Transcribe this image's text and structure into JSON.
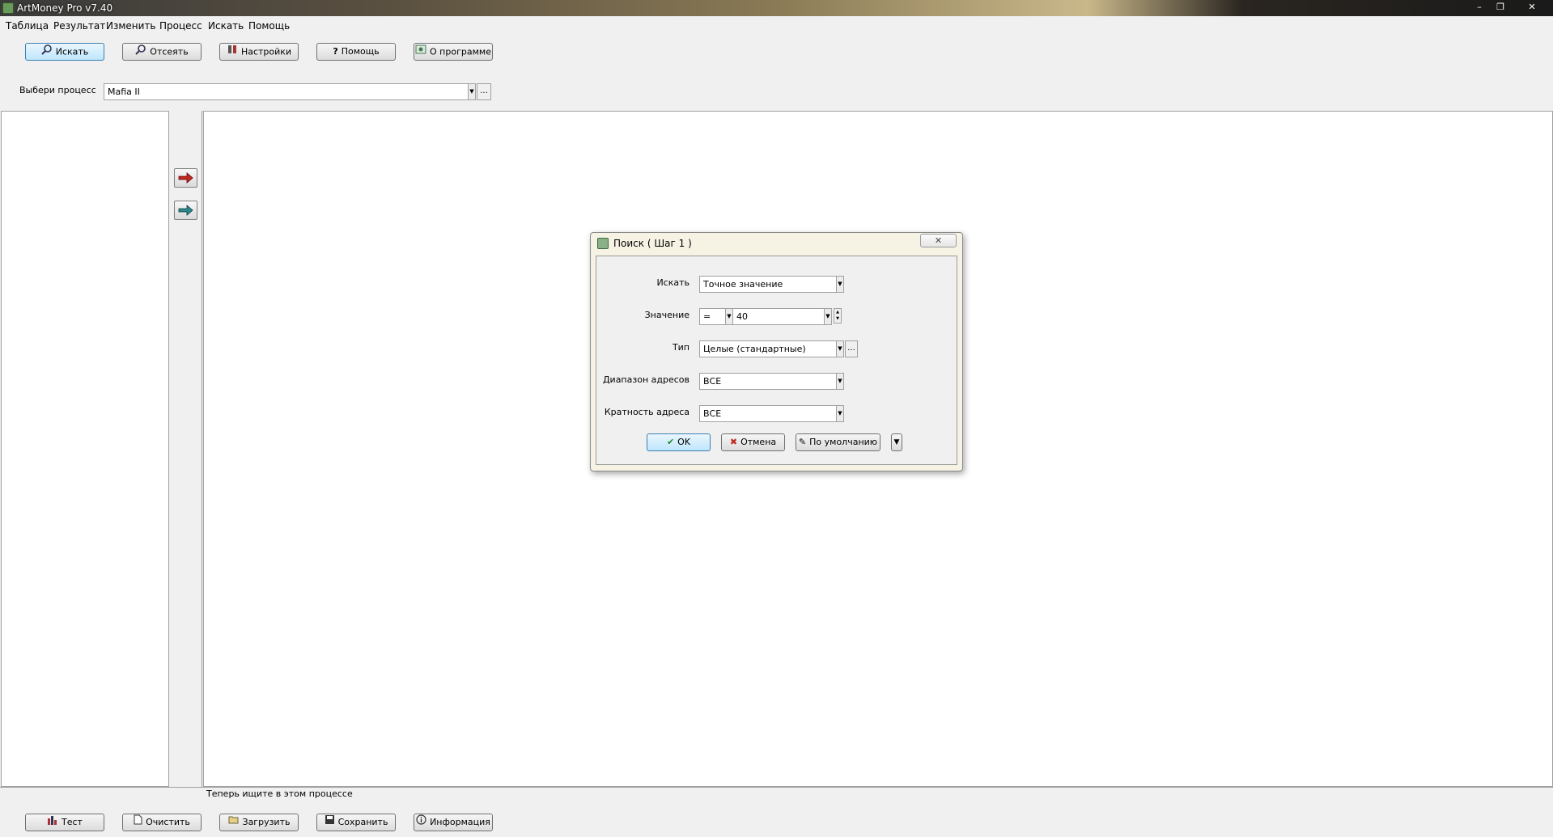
{
  "window": {
    "title": "ArtMoney Pro v7.40",
    "controls": [
      "–",
      "❐",
      "✕"
    ]
  },
  "menu": [
    "Таблица",
    "Результат",
    "Изменить",
    "Процесс",
    "Искать",
    "Помощь"
  ],
  "toolbar": {
    "search": "Искать",
    "filter": "Отсеять",
    "settings": "Настройки",
    "help": "Помощь",
    "about": "О программе"
  },
  "process": {
    "label": "Выбери процесс",
    "value": "Mafia II",
    "more": "..."
  },
  "status": "Теперь ищите в этом процессе",
  "bottom": {
    "test": "Тест",
    "clear": "Очистить",
    "load": "Загрузить",
    "save": "Сохранить",
    "info": "Информация"
  },
  "dialog": {
    "title": "Поиск ( Шаг 1 )",
    "close": "✕",
    "fields": {
      "search_label": "Искать",
      "search_value": "Точное значение",
      "value_label": "Значение",
      "operator": "=",
      "value": "40",
      "type_label": "Тип",
      "type_value": "Целые (стандартные)",
      "type_more": "...",
      "range_label": "Диапазон адресов",
      "range_value": "ВСЕ",
      "align_label": "Кратность адреса",
      "align_value": "ВСЕ"
    },
    "buttons": {
      "ok": "OK",
      "cancel": "Отмена",
      "default": "По умолчанию"
    }
  },
  "colors": {
    "accent_red": "#c0281c",
    "accent_teal": "#2a8a8a",
    "ok_green": "#1f8a2a"
  }
}
